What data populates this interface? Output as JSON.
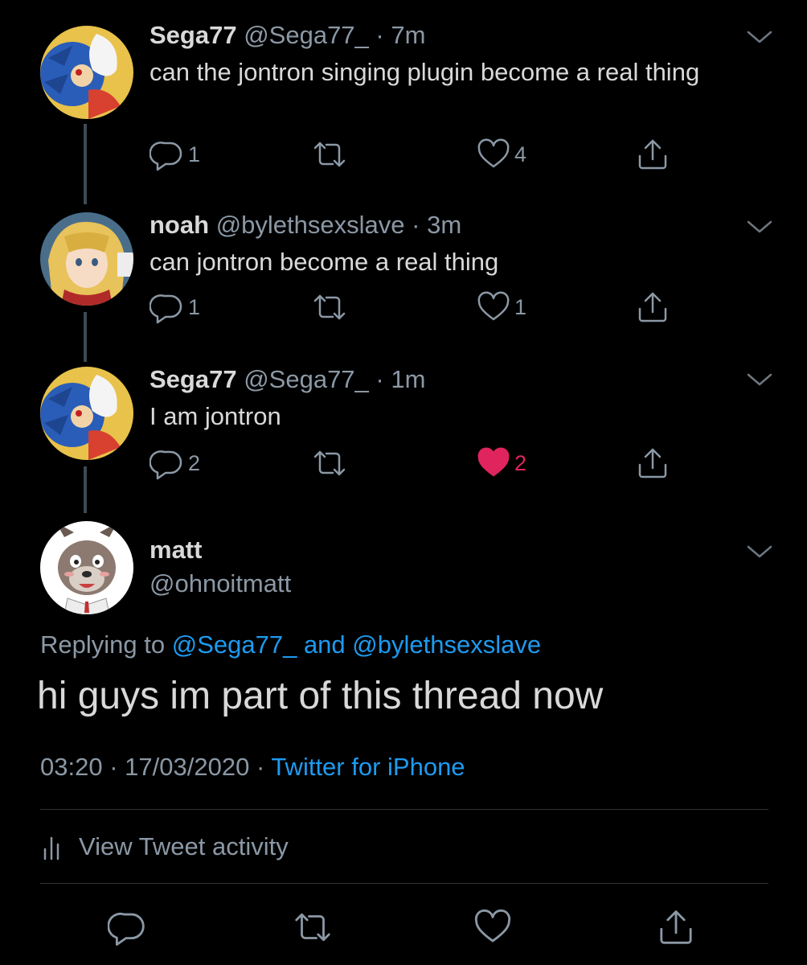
{
  "thread": [
    {
      "display_name": "Sega77",
      "handle": "@Sega77_",
      "separator": "·",
      "time": "7m",
      "text": "can the jontron singing plugin become a real thing",
      "replies": "1",
      "retweets": "",
      "likes": "4",
      "liked": false,
      "avatar": "sonic-avatar"
    },
    {
      "display_name": "noah",
      "handle": "@bylethsexslave",
      "separator": "·",
      "time": "3m",
      "text": "can jontron become a real thing",
      "replies": "1",
      "retweets": "",
      "likes": "1",
      "liked": false,
      "avatar": "anime-girl-avatar"
    },
    {
      "display_name": "Sega77",
      "handle": "@Sega77_",
      "separator": "·",
      "time": "1m",
      "text": "I am jontron",
      "replies": "2",
      "retweets": "",
      "likes": "2",
      "liked": true,
      "avatar": "sonic-avatar"
    }
  ],
  "main_tweet": {
    "display_name": "matt",
    "handle": "@ohnoitmatt",
    "replying_prefix": "Replying to",
    "replying_user1": "@Sega77_",
    "replying_and": "and",
    "replying_user2": "@bylethsexslave",
    "text": "hi guys im part of this thread now",
    "time": "03:20",
    "date": "17/03/2020",
    "separator": "·",
    "source": "Twitter for iPhone",
    "activity_label": "View Tweet activity",
    "avatar": "hyena-avatar"
  },
  "colors": {
    "background": "#000000",
    "text_primary": "#D9D9D9",
    "text_secondary": "#8B98A5",
    "link": "#1D9BF0",
    "like_active": "#E0245E",
    "thread_line": "#3D4A55"
  },
  "icons": {
    "reply": "reply-icon",
    "retweet": "retweet-icon",
    "like": "heart-icon",
    "share": "share-icon",
    "caret": "chevron-down-icon",
    "activity": "bar-chart-icon"
  }
}
